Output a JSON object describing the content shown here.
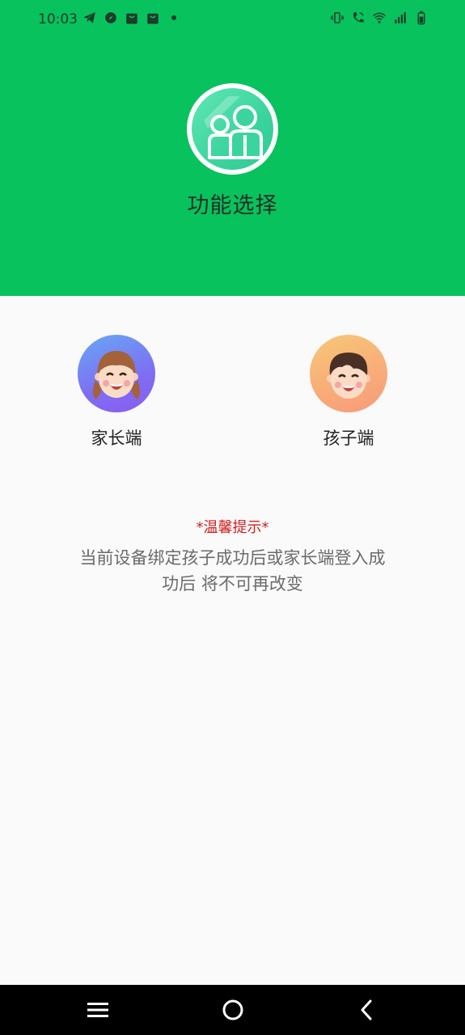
{
  "status_bar": {
    "time": "10:03",
    "left_icons": [
      "telegram-icon",
      "compass-icon",
      "shopping-bag-icon",
      "shopping-bag-icon",
      "dot-icon"
    ],
    "right_icons": [
      "vibrate-icon",
      "wifi-call-icon",
      "wifi-icon",
      "signal-icon",
      "battery-icon"
    ]
  },
  "header": {
    "title": "功能选择",
    "background_color": "#08c25d"
  },
  "roles": [
    {
      "label": "家长端",
      "icon": "girl-avatar-icon"
    },
    {
      "label": "孩子端",
      "icon": "boy-avatar-icon"
    }
  ],
  "tip": {
    "title": "*温馨提示*",
    "line1": "当前设备绑定孩子成功后或家长端登入成",
    "line2": "功后 将不可再改变"
  },
  "navbar": {
    "buttons": [
      "menu-icon",
      "home-icon",
      "back-icon"
    ]
  }
}
